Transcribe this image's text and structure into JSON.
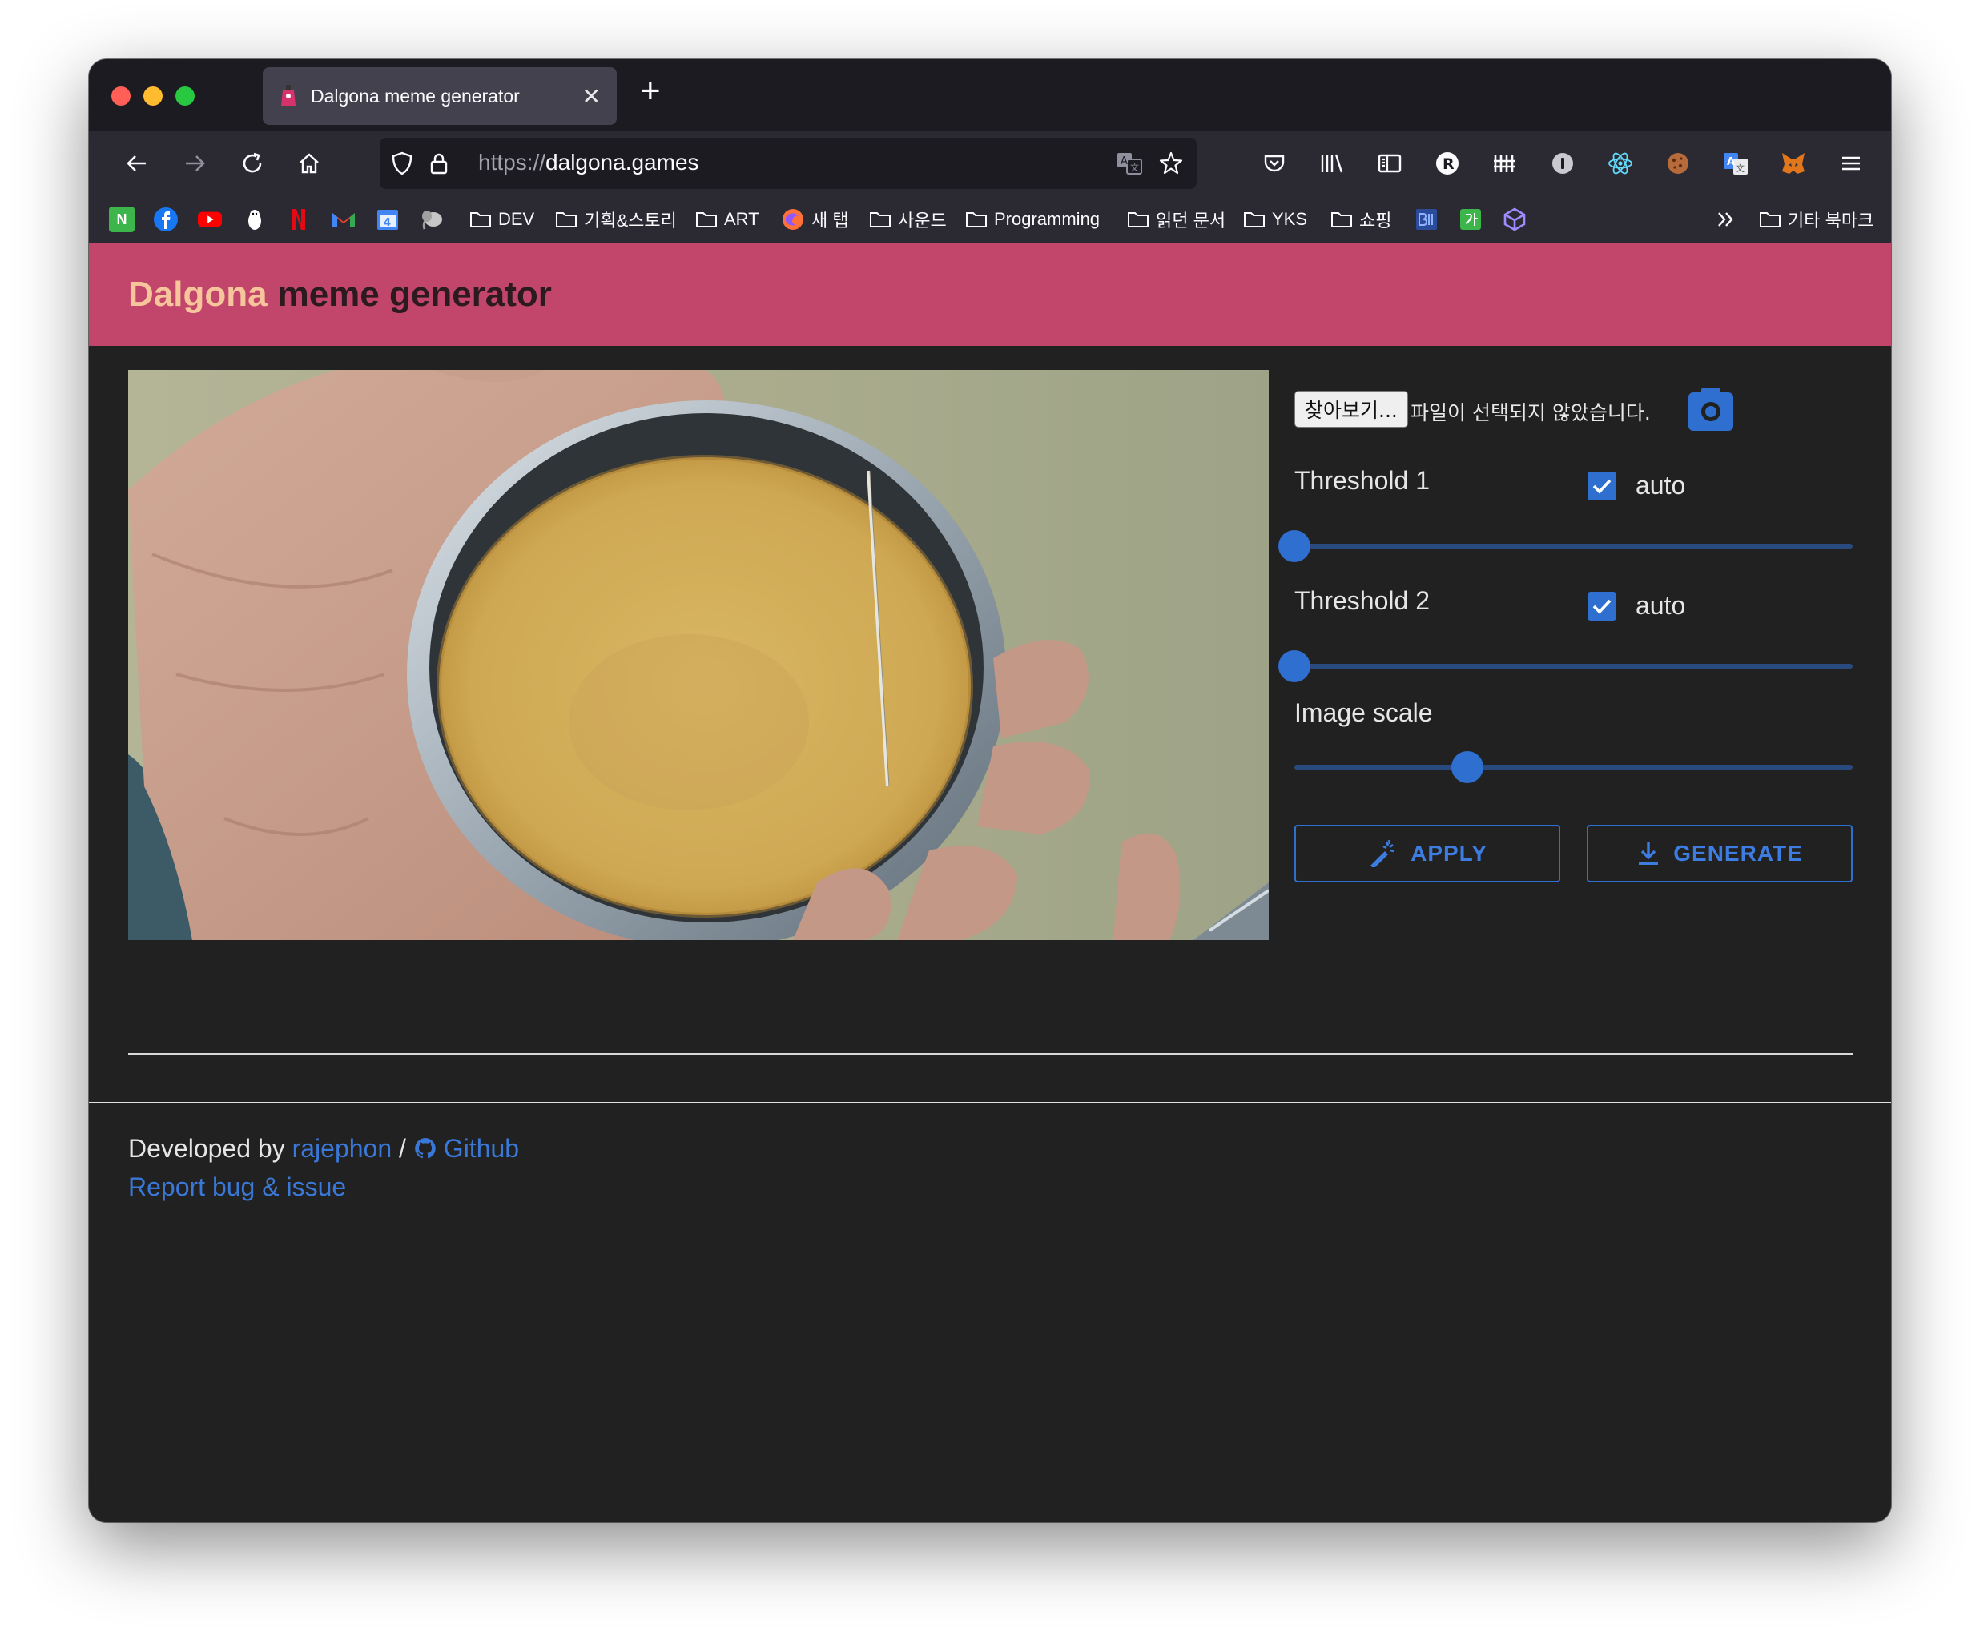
{
  "browser": {
    "tab_title": "Dalgona meme generator",
    "url_scheme": "https://",
    "url_host": "dalgona.games",
    "bookmarks": [
      {
        "label": "DEV"
      },
      {
        "label": "기획&스토리"
      },
      {
        "label": "ART"
      },
      {
        "label": "새 탭"
      },
      {
        "label": "사운드"
      },
      {
        "label": "Programming"
      },
      {
        "label": "읽던 문서"
      },
      {
        "label": "YKS"
      },
      {
        "label": "쇼핑"
      },
      {
        "label": "기타 북마크"
      }
    ]
  },
  "header": {
    "brand": "Dalgona",
    "rest": "meme generator",
    "color": "#c2456b"
  },
  "controls": {
    "file_button": "찾아보기...",
    "file_status": "파일이 선택되지 않았습니다.",
    "threshold1_label": "Threshold 1",
    "threshold1_auto": "auto",
    "threshold1_value": 0,
    "threshold2_label": "Threshold 2",
    "threshold2_auto": "auto",
    "threshold2_value": 0,
    "scale_label": "Image scale",
    "scale_value": 0.31,
    "apply_label": "APPLY",
    "generate_label": "GENERATE",
    "accent": "#2f6fcf"
  },
  "footer": {
    "developed_by": "Developed by",
    "author": "rajephon",
    "separator": "/",
    "github": "Github",
    "report": "Report bug & issue"
  }
}
